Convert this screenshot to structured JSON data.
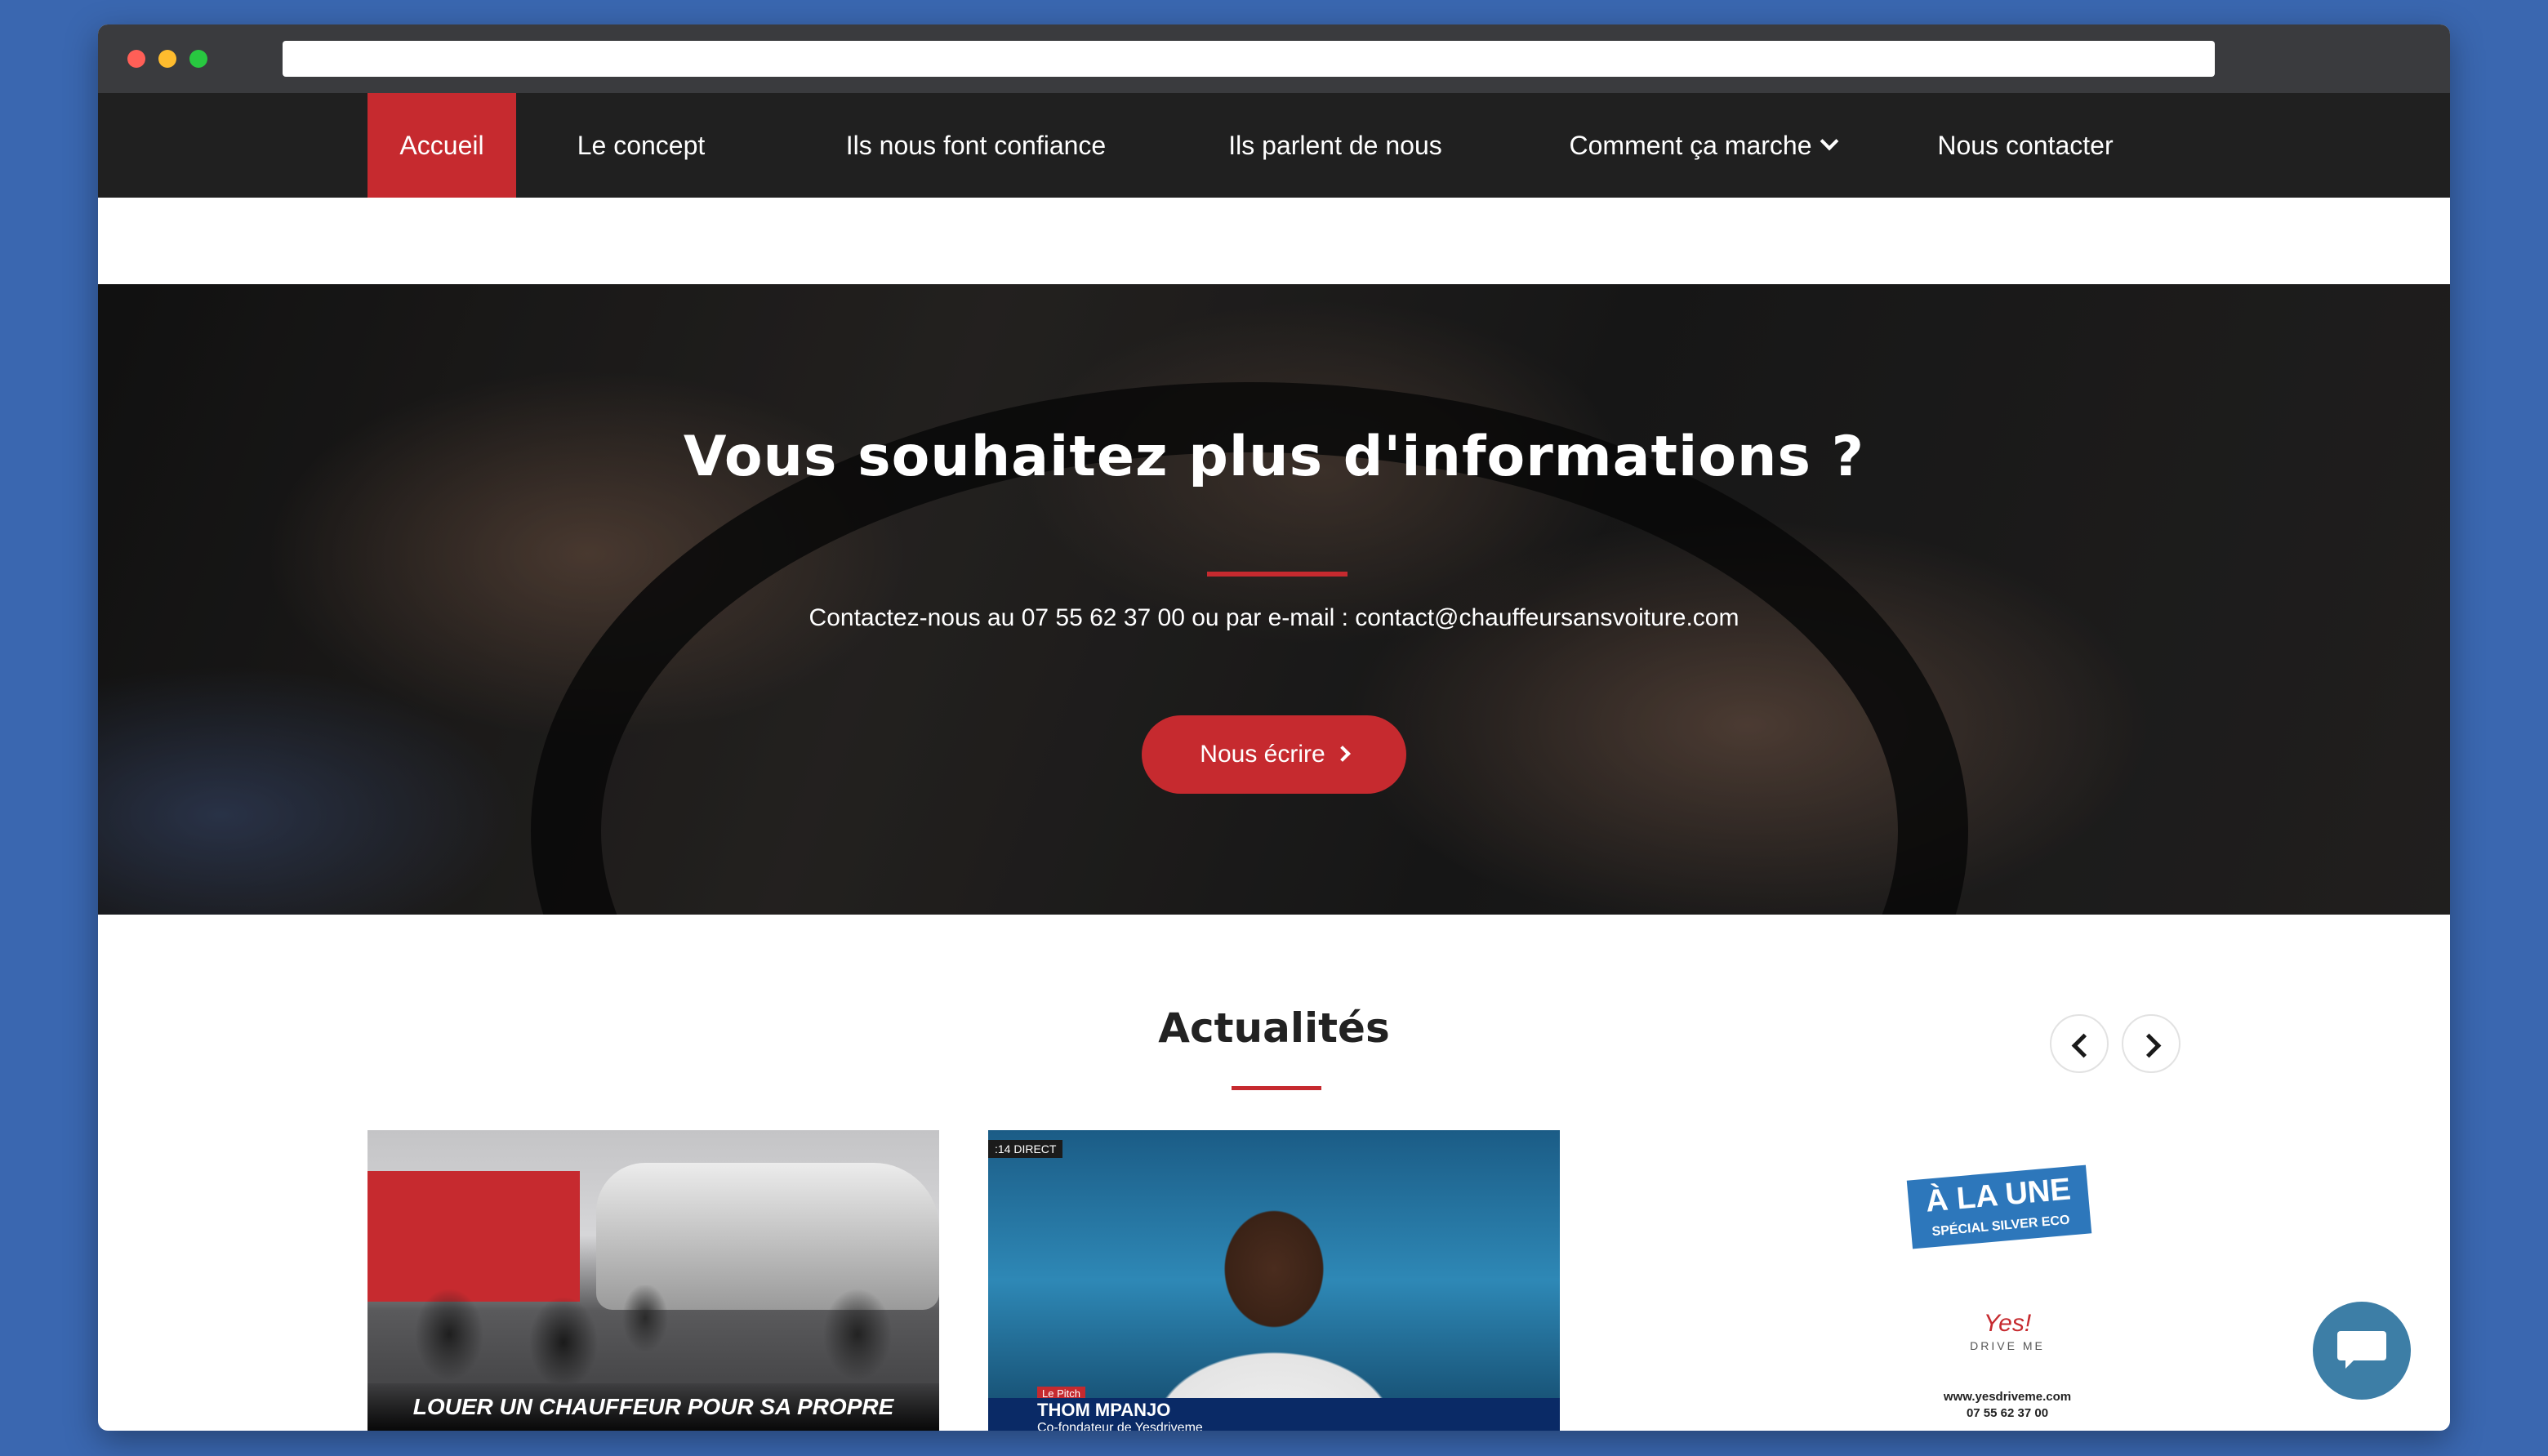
{
  "nav": {
    "items": [
      {
        "label": "Accueil",
        "active": true
      },
      {
        "label": "Le concept"
      },
      {
        "label": "Ils nous font confiance"
      },
      {
        "label": "Ils parlent de nous"
      },
      {
        "label": "Comment ça marche",
        "has_dropdown": true
      },
      {
        "label": "Nous contacter"
      }
    ]
  },
  "hero": {
    "title": "Vous souhaitez plus d'informations ?",
    "contact_text": "Contactez-nous au 07 55 62 37 00 ou par e-mail : contact@chauffeursansvoiture.com",
    "button_label": "Nous écrire"
  },
  "news": {
    "title": "Actualités",
    "cards": [
      {
        "caption": "LOUER UN CHAUFFEUR POUR SA PROPRE VOITURE"
      },
      {
        "tag": "DIRECT",
        "time": ":14",
        "segment": "Le Pitch",
        "name": "THOM MPANJO",
        "role": "Co-fondateur de Yesdriveme"
      },
      {
        "badge_line1": "À LA UNE",
        "badge_line2": "SPÉCIAL SILVER ECO",
        "logo": "Yes!",
        "logo_sub": "DRIVE ME",
        "site": "www.yesdriveme.com",
        "phone": "07 55 62 37 00"
      }
    ]
  },
  "colors": {
    "accent": "#c62a2f",
    "navbar": "#202020",
    "page_bg": "#3a67b0",
    "chat": "#3d7ea6"
  },
  "icons": {
    "dropdown": "chevron-down-icon",
    "button": "chevron-right-icon",
    "carousel_prev": "chevron-left-icon",
    "carousel_next": "chevron-right-icon",
    "chat": "chat-bubble-icon"
  }
}
